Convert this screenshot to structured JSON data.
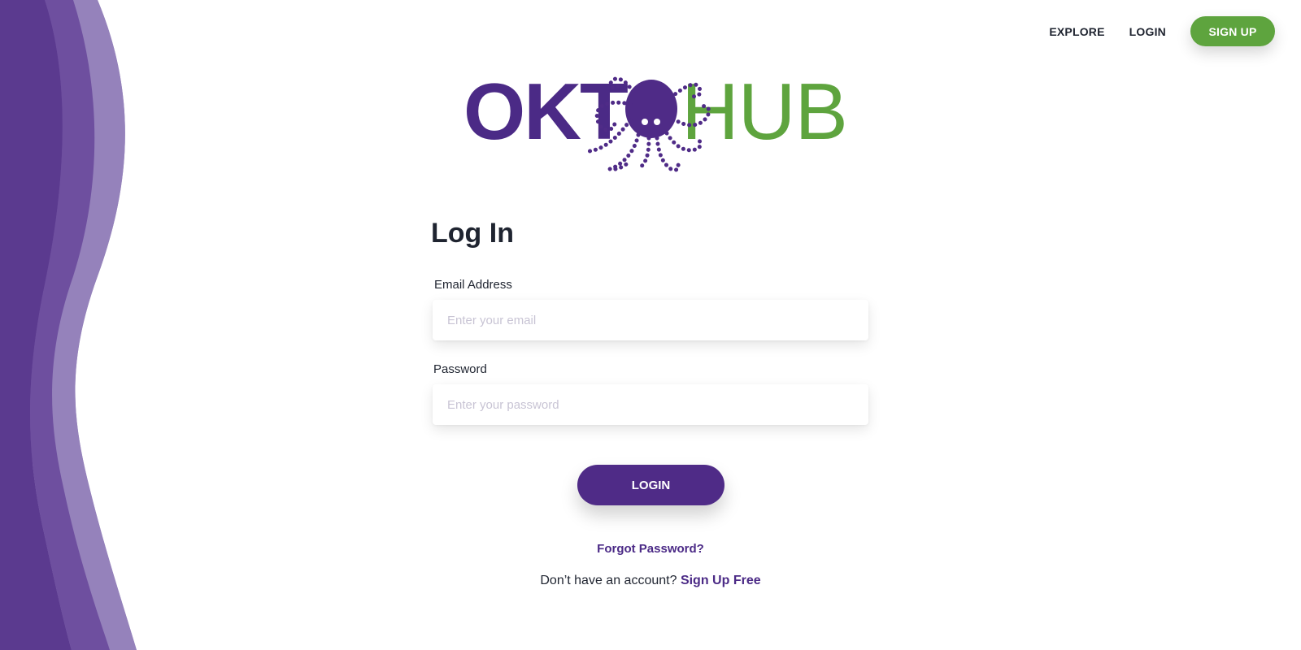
{
  "nav": {
    "explore": "EXPLORE",
    "login": "LOGIN",
    "signup": "SIGN UP"
  },
  "logo": {
    "part1": "OKT",
    "part2": "HUB",
    "icon": "octopus-icon"
  },
  "form": {
    "title": "Log In",
    "email_label": "Email Address",
    "email_placeholder": "Enter your email",
    "email_value": "",
    "password_label": "Password",
    "password_placeholder": "Enter your password",
    "password_value": "",
    "login_button": "LOGIN",
    "forgot": "Forgot Password?",
    "no_account": "Don’t have an account?",
    "signup_link": "Sign Up Free"
  },
  "colors": {
    "brand_purple": "#4f2b87",
    "brand_green": "#5ea43e",
    "wave_dark": "#5b3a8f",
    "wave_mid": "#6e4f9f",
    "wave_light": "#9582bb"
  }
}
